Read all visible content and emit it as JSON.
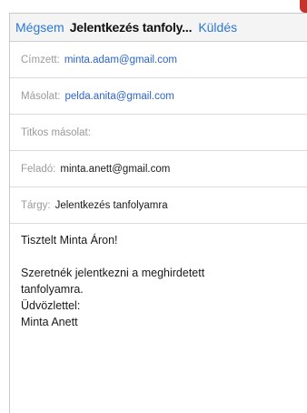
{
  "navbar": {
    "cancel_label": "Mégsem",
    "title": "Jelentkezés tanfoly...",
    "send_label": "Küldés"
  },
  "fields": {
    "to": {
      "label": "Címzett:",
      "value": "minta.adam@gmail.com"
    },
    "cc": {
      "label": "Másolat:",
      "value": "pelda.anita@gmail.com"
    },
    "bcc": {
      "label": "Titkos másolat:",
      "value": ""
    },
    "from": {
      "label": "Feladó:",
      "value": "minta.anett@gmail.com"
    },
    "subject": {
      "label": "Tárgy:",
      "value": "Jelentkezés tanfolyamra"
    }
  },
  "body": {
    "greeting": "Tisztelt Minta Áron!",
    "line1": "Szeretnék jelentkezni a meghirdetett",
    "line2": "tanfolyamra.",
    "closing": "Üdvözlettel:",
    "signature": "Minta Anett"
  },
  "colors": {
    "accent": "#2c78d4",
    "corner": "#c8322a"
  }
}
